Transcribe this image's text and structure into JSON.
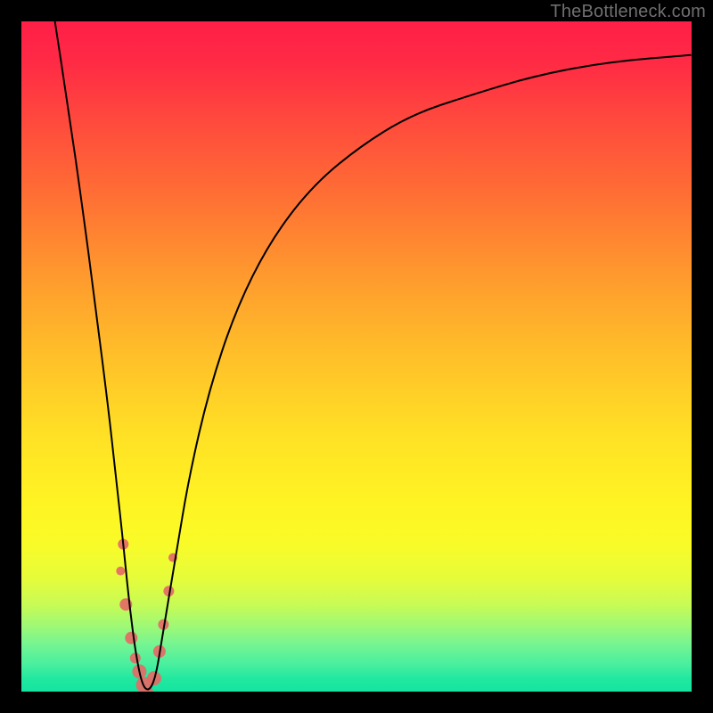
{
  "attribution": "TheBottleneck.com",
  "chart_data": {
    "type": "line",
    "title": "",
    "xlabel": "",
    "ylabel": "",
    "xlim": [
      0,
      100
    ],
    "ylim": [
      0,
      100
    ],
    "series": [
      {
        "name": "bottleneck-curve",
        "x": [
          5,
          7,
          9,
          11,
          13,
          14,
          15,
          16,
          17,
          18,
          19,
          20,
          21,
          23,
          25,
          28,
          32,
          37,
          43,
          50,
          58,
          67,
          77,
          88,
          100
        ],
        "values": [
          100,
          87,
          73,
          58,
          42,
          33,
          24,
          14,
          6,
          1,
          0,
          2,
          8,
          20,
          32,
          45,
          57,
          67,
          75,
          81,
          86,
          89,
          92,
          94,
          95
        ]
      }
    ],
    "markers": [
      {
        "x": 15.2,
        "y": 22,
        "r": 6
      },
      {
        "x": 14.8,
        "y": 18,
        "r": 5
      },
      {
        "x": 15.6,
        "y": 13,
        "r": 7
      },
      {
        "x": 16.4,
        "y": 8,
        "r": 7
      },
      {
        "x": 17.0,
        "y": 5,
        "r": 6
      },
      {
        "x": 17.6,
        "y": 3,
        "r": 8
      },
      {
        "x": 18.3,
        "y": 1,
        "r": 9
      },
      {
        "x": 19.0,
        "y": 0,
        "r": 5
      },
      {
        "x": 19.8,
        "y": 2,
        "r": 8
      },
      {
        "x": 20.6,
        "y": 6,
        "r": 7
      },
      {
        "x": 21.2,
        "y": 10,
        "r": 6
      },
      {
        "x": 22.0,
        "y": 15,
        "r": 6
      },
      {
        "x": 22.6,
        "y": 20,
        "r": 5
      }
    ],
    "marker_color": "#e46a66"
  }
}
